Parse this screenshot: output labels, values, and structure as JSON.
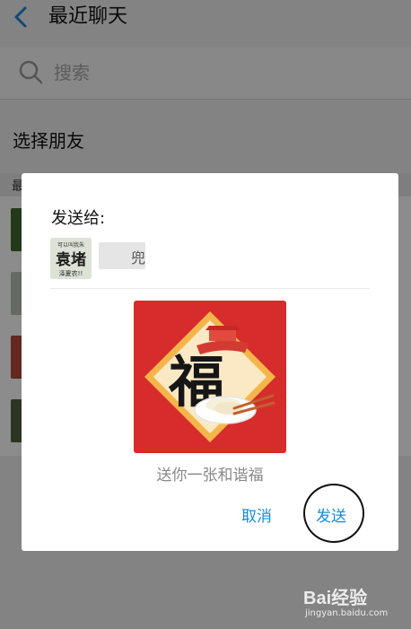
{
  "header": {
    "title": "最近聊天",
    "back_icon": "chevron-left-icon",
    "accent": "#1a8ad4"
  },
  "search": {
    "placeholder": "搜索",
    "icon": "search-icon"
  },
  "section": {
    "title": "选择朋友",
    "list_header": "最"
  },
  "dialog": {
    "send_to_label": "发送给:",
    "recipient": {
      "avatar_text_small": "可以叫我朱",
      "avatar_text_main": "袁堵",
      "avatar_text_sub": "泽夏农!!",
      "name_fragment": "兜"
    },
    "card": {
      "character": "福",
      "caption": "送你一张和谐福"
    },
    "cancel_label": "取消",
    "send_label": "发送",
    "highlight": "send-button-circled"
  },
  "watermark": {
    "logo": "Bai经验",
    "url": "jingyan.baidu.com"
  }
}
